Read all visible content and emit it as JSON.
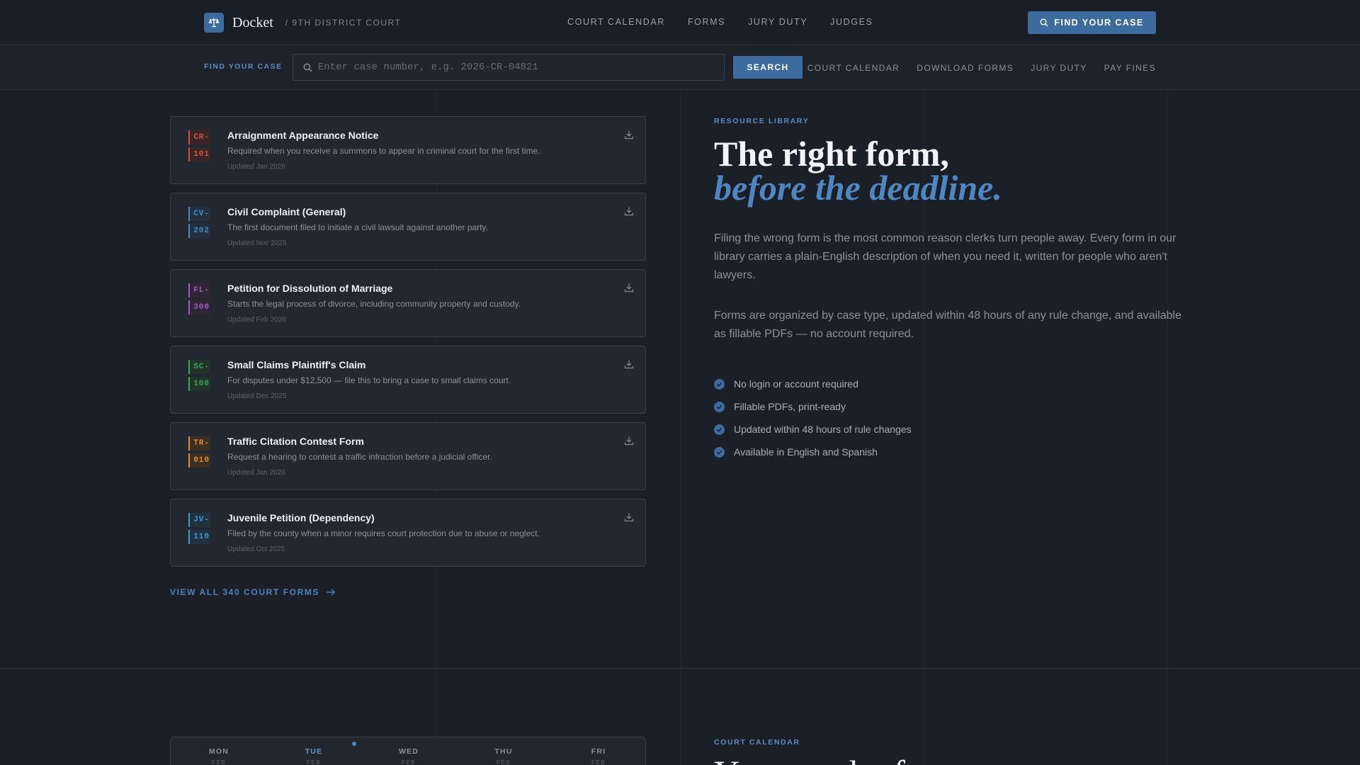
{
  "header": {
    "brand": "Docket",
    "brand_sub": "/ 9TH DISTRICT COURT",
    "nav": [
      "COURT CALENDAR",
      "FORMS",
      "JURY DUTY",
      "JUDGES"
    ],
    "cta_label": "FIND YOUR CASE"
  },
  "search": {
    "label": "FIND YOUR CASE",
    "placeholder": "Enter case number, e.g. 2026-CR-04821",
    "button_label": "SEARCH",
    "quick_links": [
      "COURT CALENDAR",
      "DOWNLOAD FORMS",
      "JURY DUTY",
      "PAY FINES"
    ]
  },
  "forms": [
    {
      "code_a": "CR-",
      "code_b": "101",
      "color": "#d0503f",
      "bg": "#3a2526",
      "title": "Arraignment Appearance Notice",
      "desc": "Required when you receive a summons to appear in criminal court for the first time.",
      "updated": "Updated Jan 2026"
    },
    {
      "code_a": "CV-",
      "code_b": "202",
      "color": "#4f86c1",
      "bg": "#23303f",
      "title": "Civil Complaint (General)",
      "desc": "The first document filed to initiate a civil lawsuit against another party.",
      "updated": "Updated Nov 2025"
    },
    {
      "code_a": "FL-",
      "code_b": "300",
      "color": "#a45bbd",
      "bg": "#302638",
      "title": "Petition for Dissolution of Marriage",
      "desc": "Starts the legal process of divorce, including community property and custody.",
      "updated": "Updated Feb 2026"
    },
    {
      "code_a": "SC-",
      "code_b": "100",
      "color": "#3fa35e",
      "bg": "#22332a",
      "title": "Small Claims Plaintiff's Claim",
      "desc": "For disputes under $12,500 — file this to bring a case to small claims court.",
      "updated": "Updated Dec 2025"
    },
    {
      "code_a": "TR-",
      "code_b": "010",
      "color": "#e08a3a",
      "bg": "#3b2e22",
      "title": "Traffic Citation Contest Form",
      "desc": "Request a hearing to contest a traffic infraction before a judicial officer.",
      "updated": "Updated Jan 2026"
    },
    {
      "code_a": "JV-",
      "code_b": "110",
      "color": "#3f9ac9",
      "bg": "#223240",
      "title": "Juvenile Petition (Dependency)",
      "desc": "Filed by the county when a minor requires court protection due to abuse or neglect.",
      "updated": "Updated Oct 2025"
    }
  ],
  "view_all": "VIEW ALL 340 COURT FORMS",
  "library": {
    "eyebrow": "RESOURCE LIBRARY",
    "headline_1": "The right form,",
    "headline_2": "before the deadline.",
    "para_1": "Filing the wrong form is the most common reason clerks turn people away. Every form in our library carries a plain-English description of when you need it, written for people who aren't lawyers.",
    "para_2": "Forms are organized by case type, updated within 48 hours of any rule change, and available as fillable PDFs — no account required.",
    "benefits": [
      "No login or account required",
      "Fillable PDFs, print-ready",
      "Updated within 48 hours of rule changes",
      "Available in English and Spanish"
    ]
  },
  "calendar": {
    "eyebrow": "COURT CALENDAR",
    "headline": "Your week of",
    "days": [
      {
        "day": "MON",
        "month": "FEB"
      },
      {
        "day": "TUE",
        "month": "FEB"
      },
      {
        "day": "WED",
        "month": "FEB"
      },
      {
        "day": "THU",
        "month": "FEB"
      },
      {
        "day": "FRI",
        "month": "FEB"
      }
    ]
  },
  "colors": {
    "accent": "#3d6b9e",
    "accent_text": "#4f86c1",
    "background": "#1b1f28"
  }
}
